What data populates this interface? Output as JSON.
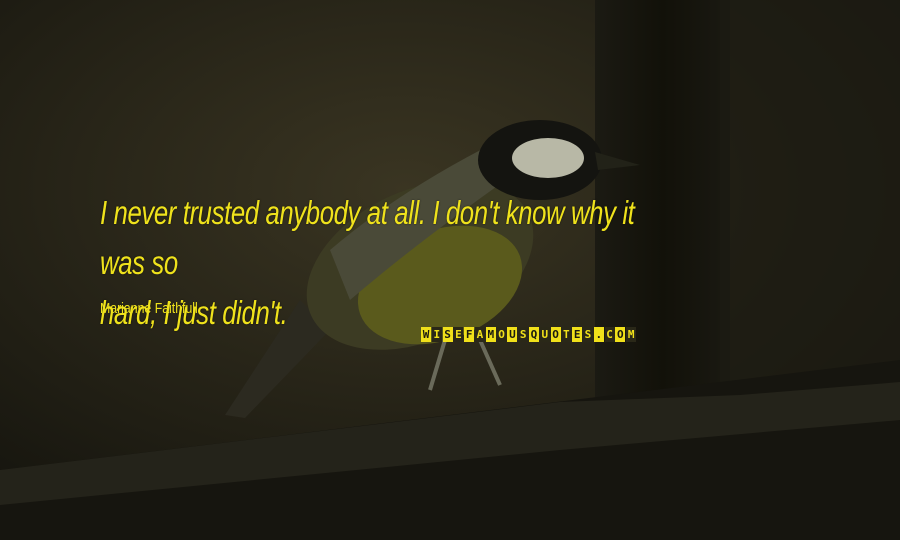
{
  "quote": {
    "line1": "I never trusted anybody at all. I don't know why it was so",
    "line2": "hard, I just didn't."
  },
  "author": "Marianne Faithfull",
  "brand": "WISEFAMOUSQUOTES.COM",
  "colors": {
    "text": "#efe21c",
    "background": "#1e1c14"
  }
}
